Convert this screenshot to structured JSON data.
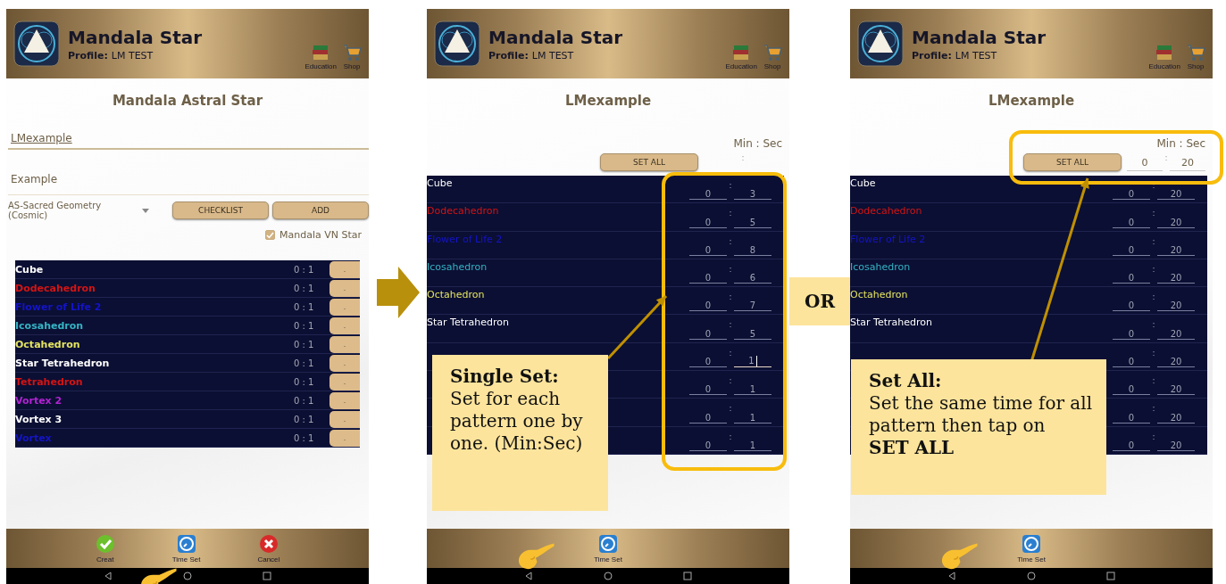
{
  "screens": [
    {
      "kind": "create",
      "header": {
        "app_title": "Mandala Star",
        "profile_label": "Profile:",
        "profile_name": "LM TEST",
        "actions": [
          "Education",
          "Shop"
        ]
      },
      "title": "Mandala Astral Star",
      "name_field": {
        "value": "LMexample"
      },
      "description_field": {
        "value": "Example"
      },
      "category_dropdown": {
        "value": "AS-Sacred Geometry (Cosmic)"
      },
      "buttons": [
        "CHECKLIST",
        "ADD"
      ],
      "checkbox": {
        "label": "Mandala VN Star",
        "checked": true
      },
      "patterns": [
        {
          "name": "Cube",
          "color": "#ffffff",
          "time": "0 : 1",
          "action": "."
        },
        {
          "name": "Dodecahedron",
          "color": "#d41414",
          "time": "0 : 1",
          "action": "."
        },
        {
          "name": "Flower of Life 2",
          "color": "#1414c8",
          "time": "0 : 1",
          "action": "."
        },
        {
          "name": "Icosahedron",
          "color": "#34b4c4",
          "time": "0 : 1",
          "action": "."
        },
        {
          "name": "Octahedron",
          "color": "#e4e460",
          "time": "0 : 1",
          "action": "."
        },
        {
          "name": "Star Tetrahedron",
          "color": "#ffffff",
          "time": "0 : 1",
          "action": "."
        },
        {
          "name": "Tetrahedron",
          "color": "#d41414",
          "time": "0 : 1",
          "action": "."
        },
        {
          "name": "Vortex 2",
          "color": "#b422d4",
          "time": "0 : 1",
          "action": "."
        },
        {
          "name": "Vortex 3",
          "color": "#ffffff",
          "time": "0 : 1",
          "action": "."
        },
        {
          "name": "Vortex",
          "color": "#1414c8",
          "time": "0 : 1",
          "action": "."
        }
      ],
      "bottom_actions": [
        {
          "kind": "confirm",
          "label": "Creat"
        },
        {
          "kind": "timer",
          "label": "Time Set"
        },
        {
          "kind": "cancel",
          "label": "Cancel"
        }
      ]
    },
    {
      "kind": "timer",
      "header": {
        "app_title": "Mandala Star",
        "profile_label": "Profile:",
        "profile_name": "LM TEST",
        "actions": [
          "Education",
          "Shop"
        ]
      },
      "title": "LMexample",
      "unit_label": "Min : Sec",
      "set_all": {
        "button": "SET ALL",
        "separator": ":"
      },
      "patterns": [
        {
          "name": "Cube",
          "color": "#ffffff",
          "minutes": "0",
          "separator": ":",
          "seconds": "3",
          "focused": false
        },
        {
          "name": "Dodecahedron",
          "color": "#d41414",
          "minutes": "0",
          "separator": ":",
          "seconds": "5",
          "focused": false
        },
        {
          "name": "Flower of Life 2",
          "color": "#1414c8",
          "minutes": "0",
          "separator": ":",
          "seconds": "8",
          "focused": false
        },
        {
          "name": "Icosahedron",
          "color": "#34b4c4",
          "minutes": "0",
          "separator": ":",
          "seconds": "6",
          "focused": false
        },
        {
          "name": "Octahedron",
          "color": "#e4e460",
          "minutes": "0",
          "separator": ":",
          "seconds": "7",
          "focused": false
        },
        {
          "name": "Star Tetrahedron",
          "color": "#ffffff",
          "minutes": "0",
          "separator": ":",
          "seconds": "5",
          "focused": false
        },
        {
          "minutes": "0",
          "separator": ":",
          "seconds": "1",
          "focused": true
        },
        {
          "minutes": "0",
          "separator": ":",
          "seconds": "1",
          "focused": false
        },
        {
          "minutes": "0",
          "separator": ":",
          "seconds": "1",
          "focused": false
        },
        {
          "minutes": "0",
          "separator": ":",
          "seconds": "1",
          "focused": false
        }
      ],
      "bottom_actions": [
        {
          "kind": "timer",
          "label": "Time Set"
        }
      ],
      "callout": {
        "title": "Single Set:",
        "text": "Set for each pattern one by one. (Min:Sec)"
      }
    },
    {
      "kind": "timer",
      "header": {
        "app_title": "Mandala Star",
        "profile_label": "Profile:",
        "profile_name": "LM TEST",
        "actions": [
          "Education",
          "Shop"
        ]
      },
      "title": "LMexample",
      "unit_label": "Min : Sec",
      "set_all": {
        "button": "SET ALL",
        "separator": ":",
        "minutes": "0",
        "seconds": "20"
      },
      "patterns": [
        {
          "name": "Cube",
          "color": "#ffffff",
          "minutes": "0",
          "separator": ":",
          "seconds": "20",
          "focused": false
        },
        {
          "name": "Dodecahedron",
          "color": "#d41414",
          "minutes": "0",
          "separator": ":",
          "seconds": "20",
          "focused": false
        },
        {
          "name": "Flower of Life 2",
          "color": "#1414c8",
          "minutes": "0",
          "separator": ":",
          "seconds": "20",
          "focused": false
        },
        {
          "name": "Icosahedron",
          "color": "#34b4c4",
          "minutes": "0",
          "separator": ":",
          "seconds": "20",
          "focused": false
        },
        {
          "name": "Octahedron",
          "color": "#e4e460",
          "minutes": "0",
          "separator": ":",
          "seconds": "20",
          "focused": false
        },
        {
          "name": "Star Tetrahedron",
          "color": "#ffffff",
          "minutes": "0",
          "separator": ":",
          "seconds": "20",
          "focused": false
        },
        {
          "minutes": "0",
          "separator": ":",
          "seconds": "20",
          "focused": false
        },
        {
          "minutes": "0",
          "separator": ":",
          "seconds": "20",
          "focused": false
        },
        {
          "minutes": "0",
          "separator": ":",
          "seconds": "20",
          "focused": false
        },
        {
          "minutes": "0",
          "separator": ":",
          "seconds": "20",
          "focused": false
        }
      ],
      "bottom_actions": [
        {
          "kind": "timer",
          "label": "Time Set"
        }
      ],
      "callout": {
        "title": "Set All:",
        "text": "Set the same time for all pattern then tap on **SET ALL**"
      }
    }
  ],
  "connectors": [
    {
      "kind": "arrow"
    },
    {
      "kind": "label",
      "text": "OR"
    }
  ]
}
